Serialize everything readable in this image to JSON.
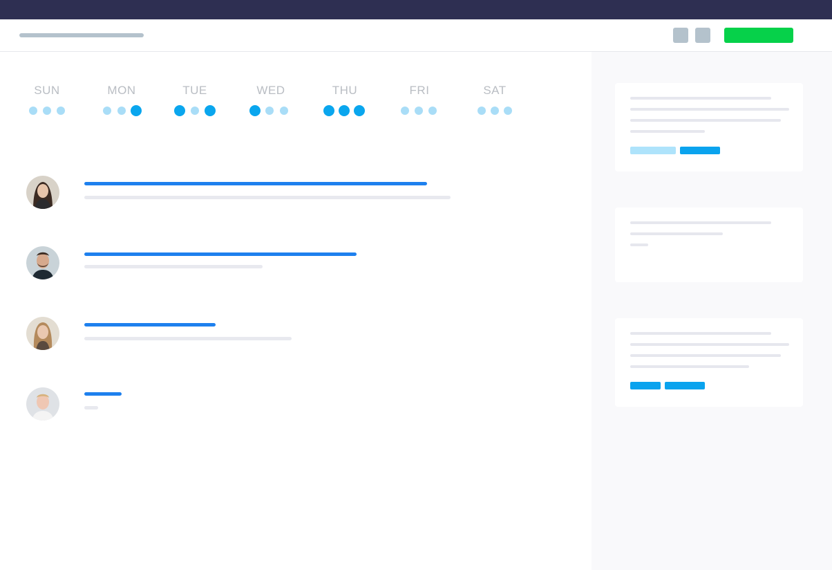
{
  "colors": {
    "topbar": "#2e2f52",
    "primary_line": "#1e80ee",
    "secondary_line": "#e8e9ef",
    "dot_active": "#0aa6ee",
    "dot_inactive": "#a9ddf7",
    "cta": "#06d14a",
    "sidebar_bg": "#f9f9fb",
    "placeholder": "#b4c2cc"
  },
  "week": {
    "days": [
      {
        "label": "SUN",
        "dots": [
          "light",
          "light",
          "light"
        ]
      },
      {
        "label": "MON",
        "dots": [
          "light",
          "light",
          "dark"
        ]
      },
      {
        "label": "TUE",
        "dots": [
          "dark",
          "light",
          "dark"
        ]
      },
      {
        "label": "WED",
        "dots": [
          "dark",
          "light",
          "light"
        ]
      },
      {
        "label": "THU",
        "dots": [
          "dark",
          "dark",
          "dark"
        ]
      },
      {
        "label": "FRI",
        "dots": [
          "light",
          "light",
          "light"
        ]
      },
      {
        "label": "SAT",
        "dots": [
          "light",
          "light",
          "light"
        ]
      }
    ]
  },
  "activity": {
    "avatars": [
      "avatar-woman-dark-hair",
      "avatar-man-beard",
      "avatar-woman-blonde",
      "avatar-man-blond"
    ]
  }
}
